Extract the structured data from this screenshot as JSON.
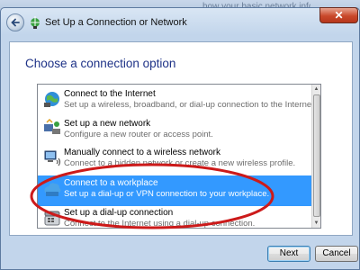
{
  "background": {
    "text": "how your basic network information and set up connections"
  },
  "window": {
    "title": "Set Up a Connection or Network",
    "close_symbol": "✕"
  },
  "content": {
    "heading": "Choose a connection option",
    "options": [
      {
        "title": "Connect to the Internet",
        "description": "Set up a wireless, broadband, or dial-up connection to the Internet.",
        "icon": "globe-network-icon",
        "selected": false
      },
      {
        "title": "Set up a new network",
        "description": "Configure a new router or access point.",
        "icon": "router-icon",
        "selected": false
      },
      {
        "title": "Manually connect to a wireless network",
        "description": "Connect to a hidden network or create a new wireless profile.",
        "icon": "wireless-computer-icon",
        "selected": false
      },
      {
        "title": "Connect to a workplace",
        "description": "Set up a dial-up or VPN connection to your workplace.",
        "icon": "workplace-vpn-icon",
        "selected": true
      },
      {
        "title": "Set up a dial-up connection",
        "description": "Connect to the Internet using a dial-up connection.",
        "icon": "telephone-icon",
        "selected": false
      }
    ]
  },
  "footer": {
    "next_label": "Next",
    "cancel_label": "Cancel"
  },
  "colors": {
    "selection": "#3399ff",
    "heading": "#1e3287",
    "annotation": "#cc1a1a"
  }
}
